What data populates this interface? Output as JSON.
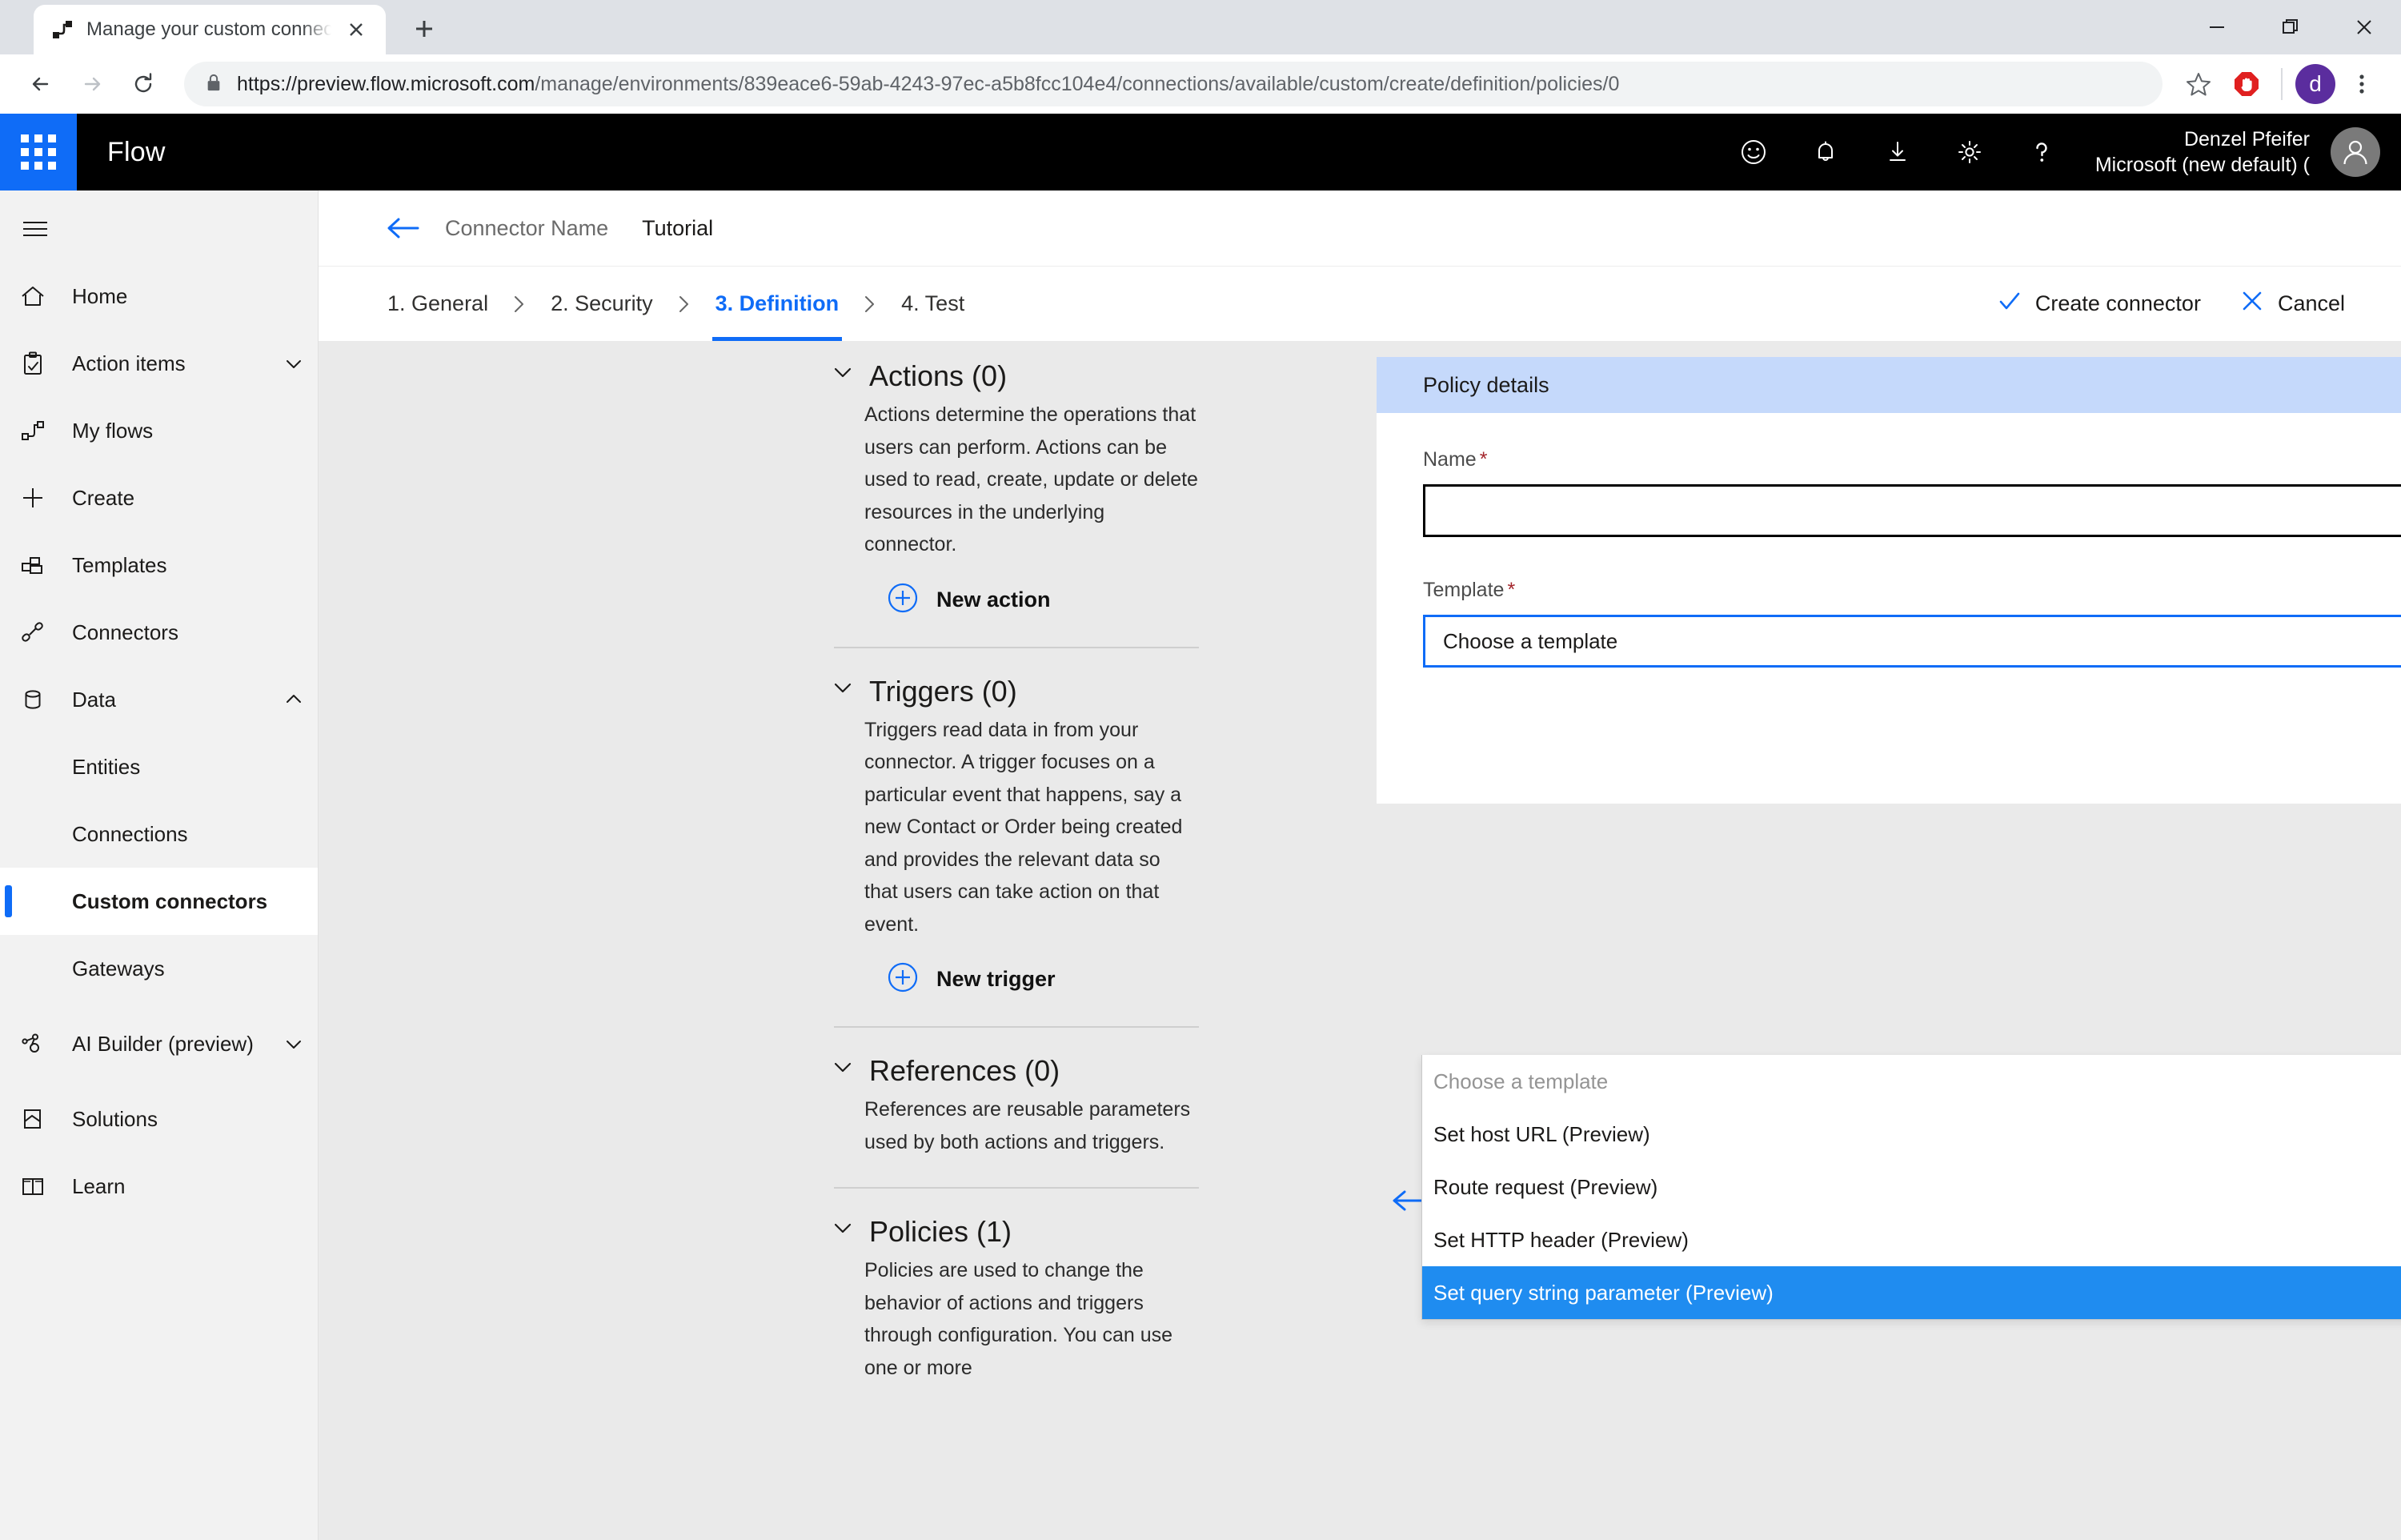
{
  "browser": {
    "tab_title": "Manage your custom connectors",
    "favicon": "flow-favicon-icon",
    "new_tab_label": "+",
    "url_scheme_host": "https://preview.flow.microsoft.com",
    "url_path": "/manage/environments/839eace6-59ab-4243-97ec-a5b8fcc104e4/connections/available/custom/create/definition/policies/0",
    "profile_initial": "d",
    "window": {
      "minimize": "minimize-icon",
      "maximize": "maximize-icon",
      "close": "close-icon"
    }
  },
  "app_header": {
    "brand": "Flow",
    "icons": [
      "waffle-icon",
      "feedback-smiley-icon",
      "notification-bell-icon",
      "download-icon",
      "settings-gear-icon",
      "help-question-icon"
    ],
    "user_name": "Denzel Pfeifer",
    "user_tenant": "Microsoft (new default) ("
  },
  "sidebar": {
    "items": [
      {
        "label": "Home",
        "icon": "home-icon",
        "chevron": "",
        "sub": false,
        "active": false
      },
      {
        "label": "Action items",
        "icon": "clipboard-check-icon",
        "chevron": "down",
        "sub": false,
        "active": false
      },
      {
        "label": "My flows",
        "icon": "flow-icon",
        "chevron": "",
        "sub": false,
        "active": false
      },
      {
        "label": "Create",
        "icon": "plus-icon",
        "chevron": "",
        "sub": false,
        "active": false
      },
      {
        "label": "Templates",
        "icon": "templates-icon",
        "chevron": "",
        "sub": false,
        "active": false
      },
      {
        "label": "Connectors",
        "icon": "plug-icon",
        "chevron": "",
        "sub": false,
        "active": false
      },
      {
        "label": "Data",
        "icon": "database-icon",
        "chevron": "up",
        "sub": false,
        "active": false
      },
      {
        "label": "Entities",
        "icon": "",
        "chevron": "",
        "sub": true,
        "active": false
      },
      {
        "label": "Connections",
        "icon": "",
        "chevron": "",
        "sub": true,
        "active": false
      },
      {
        "label": "Custom connectors",
        "icon": "",
        "chevron": "",
        "sub": true,
        "active": true
      },
      {
        "label": "Gateways",
        "icon": "",
        "chevron": "",
        "sub": true,
        "active": false
      },
      {
        "label": "AI Builder (preview)",
        "icon": "ai-builder-icon",
        "chevron": "down",
        "sub": false,
        "active": false
      },
      {
        "label": "Solutions",
        "icon": "solutions-icon",
        "chevron": "",
        "sub": false,
        "active": false
      },
      {
        "label": "Learn",
        "icon": "book-icon",
        "chevron": "",
        "sub": false,
        "active": false
      }
    ]
  },
  "breadcrumb": {
    "back_icon": "back-arrow-icon",
    "connector_name": "Connector Name",
    "current": "Tutorial"
  },
  "wizard": {
    "steps": [
      {
        "label": "1. General",
        "current": false
      },
      {
        "label": "2. Security",
        "current": false
      },
      {
        "label": "3. Definition",
        "current": true
      },
      {
        "label": "4. Test",
        "current": false
      }
    ],
    "separator": "›",
    "create_label": "Create connector",
    "cancel_label": "Cancel"
  },
  "definition": {
    "sections": [
      {
        "title": "Actions (0)",
        "body": "Actions determine the operations that users can perform. Actions can be used to read, create, update or delete resources in the underlying connector.",
        "button": "New action"
      },
      {
        "title": "Triggers (0)",
        "body": "Triggers read data in from your connector. A trigger focuses on a particular event that happens, say a new Contact or Order being created and provides the relevant data so that users can take action on that event.",
        "button": "New trigger"
      },
      {
        "title": "References (0)",
        "body": "References are reusable parameters used by both actions and triggers.",
        "button": ""
      },
      {
        "title": "Policies (1)",
        "body": "Policies are used to change the behavior of actions and triggers through configuration. You can use one or more",
        "button": ""
      }
    ]
  },
  "policy_details": {
    "panel_title": "Policy details",
    "name_label": "Name",
    "name_value": "",
    "name_placeholder": "",
    "name_error": "!",
    "template_label": "Template",
    "template_value": "Choose a template",
    "template_error": "!",
    "required_mark": "*",
    "dropdown_options": [
      {
        "label": "Choose a template",
        "placeholder": true,
        "selected": false
      },
      {
        "label": "Set host URL (Preview)",
        "placeholder": false,
        "selected": false
      },
      {
        "label": "Route request (Preview)",
        "placeholder": false,
        "selected": false
      },
      {
        "label": "Set HTTP header (Preview)",
        "placeholder": false,
        "selected": false
      },
      {
        "label": "Set query string parameter (Preview)",
        "placeholder": false,
        "selected": true
      }
    ],
    "prev_icon": "arrow-left-icon",
    "next_icon": "arrow-right-icon"
  },
  "colors": {
    "accent": "#0f6cf7",
    "panel_header": "#c5d9fb",
    "selected_option": "#1f8cf0",
    "error": "#e81123",
    "required": "#a4262c",
    "canvas": "#eaeaea",
    "sidebar": "#f2f2f2"
  }
}
